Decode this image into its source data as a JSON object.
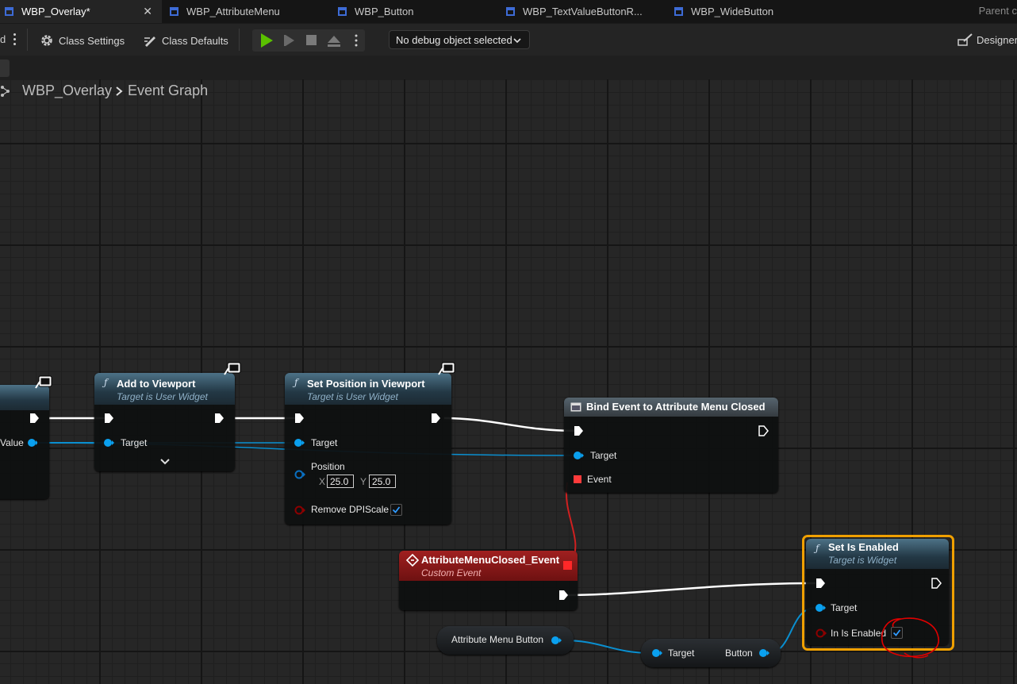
{
  "tabs": [
    {
      "label": "WBP_Overlay*",
      "active": true
    },
    {
      "label": "WBP_AttributeMenu"
    },
    {
      "label": "WBP_Button"
    },
    {
      "label": "WBP_TextValueButtonR..."
    },
    {
      "label": "WBP_WideButton"
    }
  ],
  "parent_class_label": "Parent c",
  "toolbar": {
    "class_settings": "Class Settings",
    "class_defaults": "Class Defaults",
    "debug_object": "No debug object selected",
    "designer": "Designer"
  },
  "breadcrumb": {
    "blueprint": "WBP_Overlay",
    "graph": "Event Graph"
  },
  "nodes": {
    "partial": {
      "return_value": "Value"
    },
    "add_to_viewport": {
      "title": "Add to Viewport",
      "subtitle": "Target is User Widget",
      "target": "Target"
    },
    "set_position": {
      "title": "Set Position in Viewport",
      "subtitle": "Target is User Widget",
      "target": "Target",
      "position": "Position",
      "x_label": "X",
      "x_value": "25.0",
      "y_label": "Y",
      "y_value": "25.0",
      "remove_dpi": "Remove DPIScale",
      "remove_dpi_checked": true
    },
    "bind_event": {
      "title": "Bind Event to Attribute Menu Closed",
      "target": "Target",
      "event": "Event"
    },
    "custom_event": {
      "title": "AttributeMenuClosed_Event",
      "subtitle": "Custom Event"
    },
    "set_is_enabled": {
      "title": "Set Is Enabled",
      "subtitle": "Target is Widget",
      "target": "Target",
      "in_is_enabled": "In Is Enabled",
      "in_is_enabled_checked": true
    },
    "attribute_menu_button": {
      "label": "Attribute Menu Button"
    },
    "get_button": {
      "target": "Target",
      "button": "Button"
    }
  },
  "colors": {
    "exec_pin": "#ffffff",
    "object_pin": "#00a8f0",
    "delegate_pin": "#ff3b3b",
    "bool_pin": "#8c0000",
    "vector2d_pin": "#0070c0",
    "selection": "#f0a000",
    "annotation": "#e00000"
  }
}
